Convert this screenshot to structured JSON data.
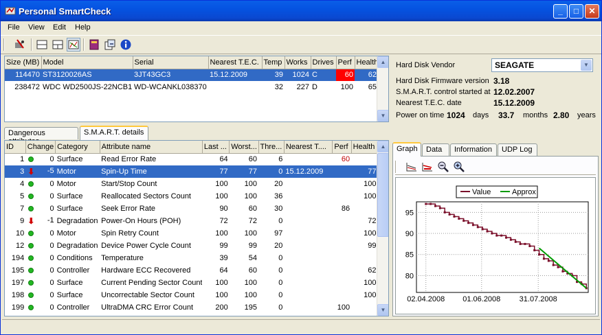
{
  "window": {
    "title": "Personal SmartCheck"
  },
  "menu": [
    "File",
    "View",
    "Edit",
    "Help"
  ],
  "toolbar": {
    "icons": [
      "smart-check-icon",
      "layout-single-icon",
      "layout-split-icon",
      "layout-grid-icon",
      "book-icon",
      "export-icon",
      "info-icon"
    ]
  },
  "drives": {
    "columns": [
      "Size (MB)",
      "Model",
      "Serial",
      "Nearest T.E.C.",
      "Temp",
      "Works",
      "Drives",
      "Perf",
      "Health"
    ],
    "rows": [
      [
        "114470",
        "ST3120026AS",
        "3JT43GC3",
        "15.12.2009",
        "39",
        "1024",
        "C",
        "60",
        "62"
      ],
      [
        "238472",
        "WDC WD2500JS-22NCB1",
        "WD-WCANKL038370",
        "",
        "32",
        "227",
        "D",
        "100",
        "65"
      ]
    ]
  },
  "info": {
    "vendor_label": "Hard Disk Vendor",
    "vendor_value": "SEAGATE",
    "firmware_label": "Hard Disk Firmware version",
    "firmware_value": "3.18",
    "smart_label": "S.M.A.R.T. control started at",
    "smart_value": "12.02.2007",
    "tec_label": "Nearest T.E.C. date",
    "tec_value": "15.12.2009",
    "power_label": "Power on time",
    "power_days": "1024",
    "days_unit": "days",
    "power_months": "33.7",
    "months_unit": "months",
    "power_years": "2.80",
    "years_unit": "years"
  },
  "left_tabs": [
    "Dangerous attributes",
    "S.M.A.R.T. details"
  ],
  "attributes": {
    "columns": [
      "ID",
      "Change",
      "Category",
      "Attribute name",
      "Last ...",
      "Worst...",
      "Thre...",
      "Nearest T....",
      "Perf",
      "Health"
    ],
    "rows": [
      {
        "id": "1",
        "trend": "ok",
        "change": "0",
        "category": "Surface",
        "name": "Read Error Rate",
        "last": "64",
        "worst": "60",
        "thre": "6",
        "nearest": "",
        "perf": "60",
        "health": "",
        "perf_red": true
      },
      {
        "id": "3",
        "trend": "down",
        "change": "-5",
        "category": "Motor",
        "name": "Spin-Up Time",
        "last": "77",
        "worst": "77",
        "thre": "0",
        "nearest": "15.12.2009",
        "perf": "",
        "health": "77",
        "selected": true
      },
      {
        "id": "4",
        "trend": "ok",
        "change": "0",
        "category": "Motor",
        "name": "Start/Stop Count",
        "last": "100",
        "worst": "100",
        "thre": "20",
        "nearest": "",
        "perf": "",
        "health": "100"
      },
      {
        "id": "5",
        "trend": "ok",
        "change": "0",
        "category": "Surface",
        "name": "Reallocated Sectors Count",
        "last": "100",
        "worst": "100",
        "thre": "36",
        "nearest": "",
        "perf": "",
        "health": "100"
      },
      {
        "id": "7",
        "trend": "ok",
        "change": "0",
        "category": "Surface",
        "name": "Seek Error Rate",
        "last": "90",
        "worst": "60",
        "thre": "30",
        "nearest": "",
        "perf": "86",
        "health": ""
      },
      {
        "id": "9",
        "trend": "down",
        "change": "-1",
        "category": "Degradation",
        "name": "Power-On Hours (POH)",
        "last": "72",
        "worst": "72",
        "thre": "0",
        "nearest": "",
        "perf": "",
        "health": "72"
      },
      {
        "id": "10",
        "trend": "ok",
        "change": "0",
        "category": "Motor",
        "name": "Spin Retry Count",
        "last": "100",
        "worst": "100",
        "thre": "97",
        "nearest": "",
        "perf": "",
        "health": "100"
      },
      {
        "id": "12",
        "trend": "ok",
        "change": "0",
        "category": "Degradation",
        "name": "Device Power Cycle Count",
        "last": "99",
        "worst": "99",
        "thre": "20",
        "nearest": "",
        "perf": "",
        "health": "99"
      },
      {
        "id": "194",
        "trend": "ok",
        "change": "0",
        "category": "Conditions",
        "name": "Temperature",
        "last": "39",
        "worst": "54",
        "thre": "0",
        "nearest": "",
        "perf": "",
        "health": ""
      },
      {
        "id": "195",
        "trend": "ok",
        "change": "0",
        "category": "Controller",
        "name": "Hardware ECC Recovered",
        "last": "64",
        "worst": "60",
        "thre": "0",
        "nearest": "",
        "perf": "",
        "health": "62"
      },
      {
        "id": "197",
        "trend": "ok",
        "change": "0",
        "category": "Surface",
        "name": "Current Pending Sector Count",
        "last": "100",
        "worst": "100",
        "thre": "0",
        "nearest": "",
        "perf": "",
        "health": "100"
      },
      {
        "id": "198",
        "trend": "ok",
        "change": "0",
        "category": "Surface",
        "name": "Uncorrectable Sector Count",
        "last": "100",
        "worst": "100",
        "thre": "0",
        "nearest": "",
        "perf": "",
        "health": "100"
      },
      {
        "id": "199",
        "trend": "ok",
        "change": "0",
        "category": "Controller",
        "name": "UltraDMA CRC Error Count",
        "last": "200",
        "worst": "195",
        "thre": "0",
        "nearest": "",
        "perf": "100",
        "health": ""
      }
    ]
  },
  "right_tabs": [
    "Graph",
    "Data",
    "Information",
    "UDP Log"
  ],
  "graph_tools": [
    "chart-line-icon",
    "chart-line-red-icon",
    "zoom-out-icon",
    "zoom-in-icon"
  ],
  "chart_data": {
    "type": "line",
    "series": [
      {
        "name": "Value",
        "color": "#7A0F2A",
        "x": [
          0,
          5,
          10,
          15,
          20,
          25,
          30,
          35,
          40,
          45,
          50,
          55,
          60,
          65,
          70,
          75,
          80,
          85,
          90,
          95,
          100,
          105,
          110,
          115,
          120,
          125,
          130,
          135,
          140,
          145,
          150,
          155,
          160,
          165,
          170
        ],
        "y": [
          97,
          97,
          96.5,
          96,
          95,
          94.5,
          94,
          93.5,
          93,
          92.5,
          92,
          91.5,
          91,
          90.5,
          90,
          89.5,
          89.5,
          89,
          88.5,
          88,
          87.5,
          87.5,
          87,
          86,
          85,
          84,
          83.5,
          82.5,
          82,
          81,
          80.5,
          80,
          78.5,
          78,
          77
        ]
      },
      {
        "name": "Approx",
        "color": "#009A00",
        "x": [
          120,
          170
        ],
        "y": [
          86.5,
          77
        ]
      }
    ],
    "ylim": [
      76,
      97.5
    ],
    "y_ticks": [
      95,
      90,
      85,
      80
    ],
    "x_ticks": [
      "02.04.2008",
      "01.06.2008",
      "31.07.2008"
    ],
    "x_tick_pos": [
      0,
      59,
      119
    ],
    "xlim": [
      -10,
      172
    ],
    "grid": true,
    "legend": "top-center"
  }
}
